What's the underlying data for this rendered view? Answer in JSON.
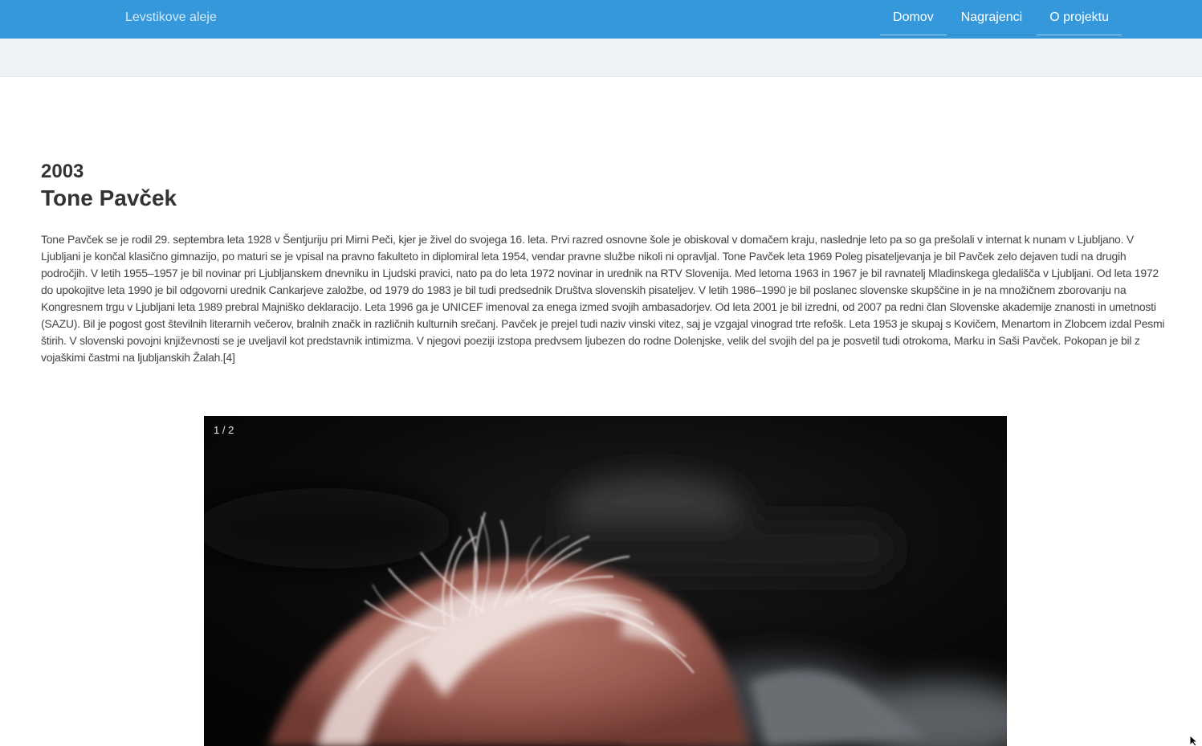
{
  "header": {
    "brand": "Levstikove aleje",
    "nav": [
      {
        "label": "Domov"
      },
      {
        "label": "Nagrajenci"
      },
      {
        "label": "O projektu"
      }
    ],
    "active_nav": "Nagrajenci",
    "color": "#3498db"
  },
  "awardee": {
    "year": "2003",
    "name": "Tone Pavček",
    "bio": "Tone Pavček se je rodil 29. septembra leta 1928 v Šentjuriju pri Mirni Peči, kjer je živel do svojega 16. leta. Prvi razred osnovne šole je obiskoval v domačem kraju, naslednje leto pa so ga prešolali v internat k nunam v Ljubljano. V Ljubljani je končal klasično gimnazijo, po maturi se je vpisal na pravno fakulteto in diplomiral leta 1954, vendar pravne službe nikoli ni opravljal. Tone Pavček leta 1969 Poleg pisateljevanja je bil Pavček zelo dejaven tudi na drugih področjih. V letih 1955–1957 je bil novinar pri Ljubljanskem dnevniku in Ljudski pravici, nato pa do leta 1972 novinar in urednik na RTV Slovenija. Med letoma 1963 in 1967 je bil ravnatelj Mladinskega gledališča v Ljubljani. Od leta 1972 do upokojitve leta 1990 je bil odgovorni urednik Cankarjeve založbe, od 1979 do 1983 je bil tudi predsednik Društva slovenskih pisateljev. V letih 1986–1990 je bil poslanec slovenske skupščine in je na množičnem zborovanju na Kongresnem trgu v Ljubljani leta 1989 prebral Majniško deklaracijo. Leta 1996 ga je UNICEF imenoval za enega izmed svojih ambasadorjev. Od leta 2001 je bil izredni, od 2007 pa redni član Slovenske akademije znanosti in umetnosti (SAZU). Bil je pogost gost številnih literarnih večerov, bralnih značk in različnih kulturnih srečanj. Pavček je prejel tudi naziv vinski vitez, saj je vzgajal vinograd trte refošk. Leta 1953 je skupaj s Kovičem, Menartom in Zlobcem izdal Pesmi štirih. V slovenski povojni književnosti se je uveljavil kot predstavnik intimizma. V njegovi poeziji izstopa predvsem ljubezen do rodne Dolenjske, velik del svojih del pa je posvetil tudi otrokoma, Marku in Saši Pavček. Pokopan je bil z vojaškimi častmi na ljubljanskih Žalah.[4]"
  },
  "gallery": {
    "counter": "1 / 2",
    "current": 1,
    "total": 2
  }
}
